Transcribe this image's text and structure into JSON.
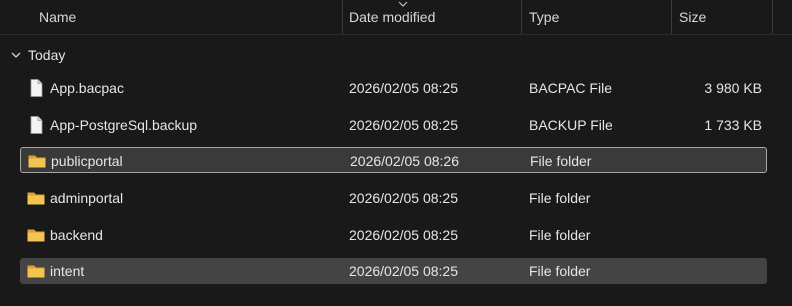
{
  "columns": {
    "name": "Name",
    "date": "Date modified",
    "type": "Type",
    "size": "Size"
  },
  "sort": {
    "column": "date",
    "icon": "sort-chevron-icon"
  },
  "group": {
    "label": "Today",
    "icon": "chevron-down-icon"
  },
  "files": [
    {
      "name": "App.bacpac",
      "date": "2026/02/05 08:25",
      "type": "BACPAC File",
      "size": "3 980 KB",
      "icon": "file-icon"
    },
    {
      "name": "App-PostgreSql.backup",
      "date": "2026/02/05 08:25",
      "type": "BACKUP File",
      "size": "1 733 KB",
      "icon": "file-icon"
    },
    {
      "name": "publicportal",
      "date": "2026/02/05 08:26",
      "type": "File folder",
      "size": "",
      "icon": "folder-icon",
      "state": "selected"
    },
    {
      "name": "adminportal",
      "date": "2026/02/05 08:25",
      "type": "File folder",
      "size": "",
      "icon": "folder-icon"
    },
    {
      "name": "backend",
      "date": "2026/02/05 08:25",
      "type": "File folder",
      "size": "",
      "icon": "folder-icon"
    },
    {
      "name": "intent",
      "date": "2026/02/05 08:25",
      "type": "File folder",
      "size": "",
      "icon": "folder-icon",
      "state": "hover"
    }
  ],
  "colors": {
    "background": "#191919",
    "selected_row": "#3a3a3a",
    "hover_row": "#444444",
    "folder": "#f0c048"
  }
}
